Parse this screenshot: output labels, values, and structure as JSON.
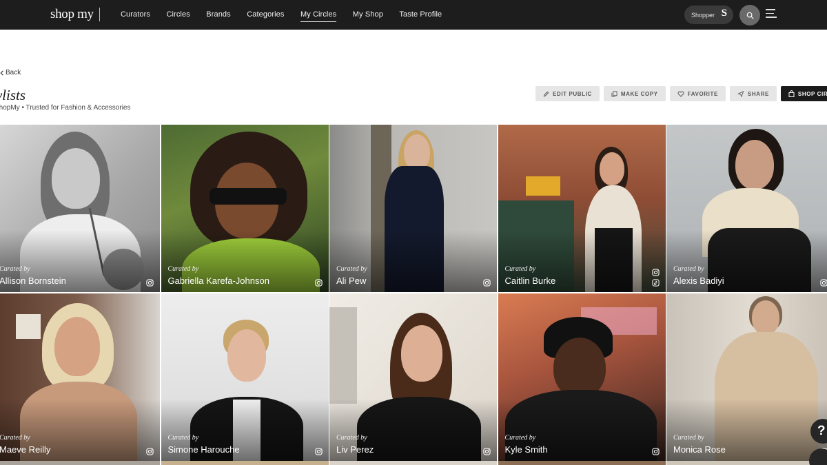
{
  "brand": {
    "logo_text": "shop my"
  },
  "nav": {
    "items": [
      {
        "label": "Curators",
        "active": false
      },
      {
        "label": "Circles",
        "active": false
      },
      {
        "label": "Brands",
        "active": false
      },
      {
        "label": "Categories",
        "active": false
      },
      {
        "label": "My Circles",
        "active": true
      },
      {
        "label": "My Shop",
        "active": false
      },
      {
        "label": "Taste Profile",
        "active": false
      }
    ]
  },
  "account": {
    "label": "Shopper",
    "initial": "S"
  },
  "page": {
    "back_label": "Back",
    "title": "tylists",
    "subtitle": "ShopMy • Trusted for Fashion & Accessories"
  },
  "actions": [
    {
      "label": "EDIT PUBLIC",
      "icon": "pencil-icon"
    },
    {
      "label": "MAKE COPY",
      "icon": "copy-icon"
    },
    {
      "label": "FAVORITE",
      "icon": "heart-icon"
    },
    {
      "label": "SHARE",
      "icon": "share-icon"
    },
    {
      "label": "SHOP CIRCLE",
      "icon": "bag-icon"
    }
  ],
  "curated_by_label": "Curated by",
  "curators": [
    {
      "name": "Allison Bornstein",
      "socials": [
        "instagram"
      ]
    },
    {
      "name": "Gabriella Karefa-Johnson",
      "socials": [
        "instagram"
      ]
    },
    {
      "name": "Ali Pew",
      "socials": [
        "instagram"
      ]
    },
    {
      "name": "Caitlin Burke",
      "socials": [
        "instagram",
        "tiktok"
      ]
    },
    {
      "name": "Alexis Badiyi",
      "socials": [
        "instagram"
      ]
    },
    {
      "name": "Maeve Reilly",
      "socials": [
        "instagram"
      ]
    },
    {
      "name": "Simone Harouche",
      "socials": [
        "instagram"
      ]
    },
    {
      "name": "Liv Perez",
      "socials": [
        "instagram"
      ]
    },
    {
      "name": "Kyle Smith",
      "socials": [
        "instagram"
      ]
    },
    {
      "name": "Monica Rose",
      "socials": [
        "instagram"
      ]
    }
  ],
  "help": {
    "label": "?"
  },
  "colors": {
    "topbar": "#1d1d1d",
    "button_light": "#e6e6e6",
    "button_dark": "#1b1b1b"
  }
}
